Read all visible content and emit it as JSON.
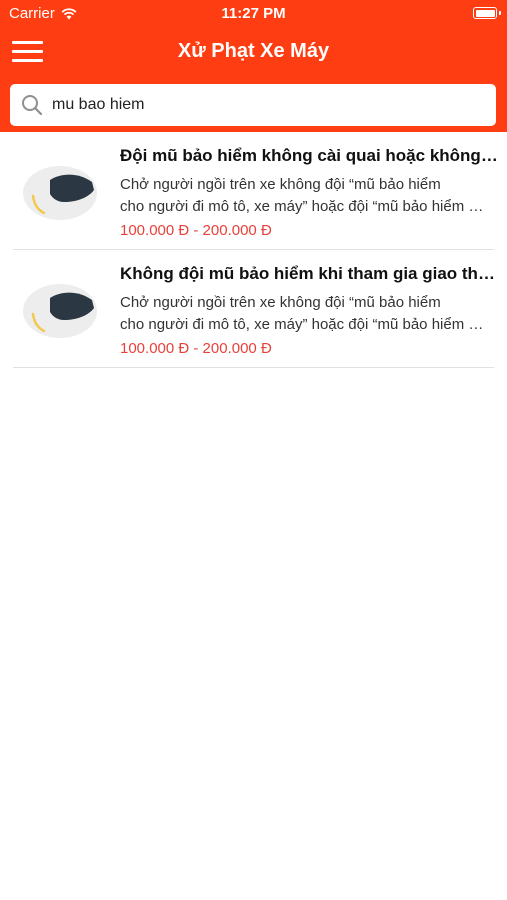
{
  "status_bar": {
    "carrier": "Carrier",
    "time": "11:27 PM",
    "wifi_icon": "wifi-icon",
    "battery_icon": "battery-icon"
  },
  "nav": {
    "title": "Xử Phạt Xe Máy",
    "menu_icon": "hamburger-menu-icon"
  },
  "search": {
    "value": "mu bao hiem",
    "icon": "search-icon"
  },
  "colors": {
    "accent": "#ff3d12",
    "price": "#e8413a"
  },
  "results": [
    {
      "title": "Đội mũ bảo hiểm không cài quai hoặc không cài quai đúng quy cách",
      "desc_line1": "Chở người ngồi trên xe không đội “mũ bảo hiểm",
      "desc_line2": "cho người đi mô tô, xe máy” hoặc đội “mũ bảo hiểm cho người đi mô tô, xe máy” không cài quai đúng quy cách",
      "price": "100.000 Đ - 200.000 Đ",
      "icon": "helmet-icon"
    },
    {
      "title": "Không đội mũ bảo hiểm khi tham gia giao thông",
      "desc_line1": "Chở người ngồi trên xe không đội “mũ bảo hiểm",
      "desc_line2": "cho người đi mô tô, xe máy” hoặc đội “mũ bảo hiểm cho người đi mô tô, xe máy” không cài quai đúng quy cách",
      "price": "100.000 Đ - 200.000 Đ",
      "icon": "helmet-icon"
    }
  ]
}
